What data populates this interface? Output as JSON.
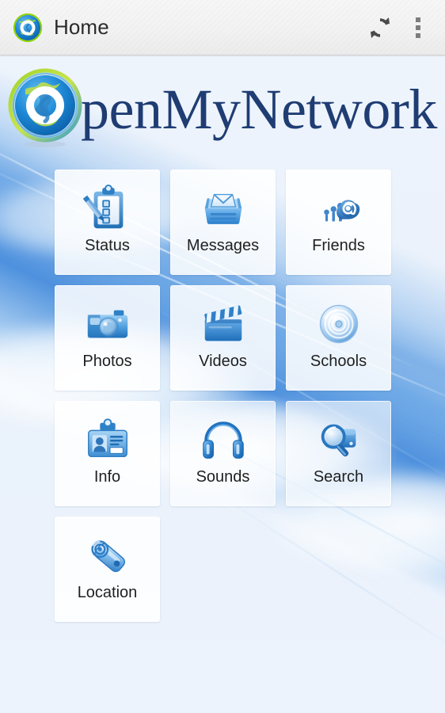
{
  "action_bar": {
    "app_icon": "globe-app-icon",
    "title": "Home",
    "refresh_label": "refresh-icon",
    "overflow_label": "overflow-menu-icon"
  },
  "brand": {
    "logo_icon": "globe-logo-icon",
    "name": "penMyNetwork",
    "full_name": "OpenMyNetwork"
  },
  "colors": {
    "brand_navy": "#1f3d73",
    "icon_blue": "#2f7fd0",
    "wallpaper_blue": "#4a8cdc",
    "tile_bg": "#ffffff",
    "label_text": "#1f1f1f",
    "action_bar_bg": "#f2f2f2"
  },
  "grid": {
    "columns": 3,
    "tiles": [
      {
        "id": "status",
        "label": "Status",
        "icon": "clipboard-pencil-icon",
        "translucent": false
      },
      {
        "id": "messages",
        "label": "Messages",
        "icon": "inbox-envelope-icon",
        "translucent": false
      },
      {
        "id": "friends",
        "label": "Friends",
        "icon": "people-at-sign-icon",
        "translucent": false
      },
      {
        "id": "photos",
        "label": "Photos",
        "icon": "camera-icon",
        "translucent": false
      },
      {
        "id": "videos",
        "label": "Videos",
        "icon": "clapperboard-icon",
        "translucent": false
      },
      {
        "id": "schools",
        "label": "Schools",
        "icon": "disc-ripple-icon",
        "translucent": false
      },
      {
        "id": "info",
        "label": "Info",
        "icon": "id-badge-icon",
        "translucent": false
      },
      {
        "id": "sounds",
        "label": "Sounds",
        "icon": "headphones-icon",
        "translucent": true
      },
      {
        "id": "search",
        "label": "Search",
        "icon": "magnifier-drive-icon",
        "translucent": true
      },
      {
        "id": "location",
        "label": "Location",
        "icon": "tag-target-icon",
        "translucent": false
      }
    ]
  }
}
